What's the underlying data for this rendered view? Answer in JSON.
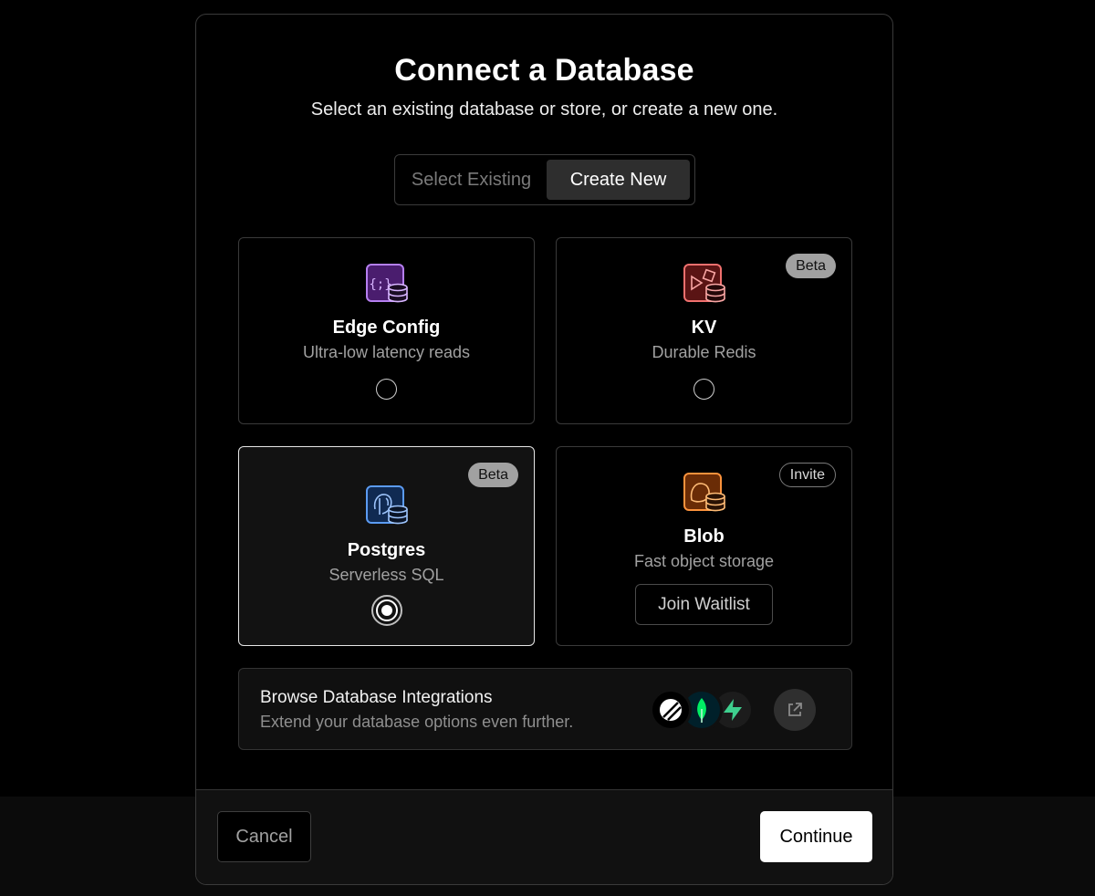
{
  "dialog": {
    "title": "Connect a Database",
    "subtitle": "Select an existing database or store, or create a new one."
  },
  "tabs": [
    {
      "label": "Select Existing",
      "active": false
    },
    {
      "label": "Create New",
      "active": true
    }
  ],
  "options": [
    {
      "title": "Edge Config",
      "description": "Ultra-low latency reads",
      "icon": "edge-config-icon",
      "color": "#a855f7",
      "selected": false
    },
    {
      "title": "KV",
      "description": "Durable Redis",
      "badge": "Beta",
      "icon": "kv-icon",
      "color": "#ef4444",
      "selected": false
    },
    {
      "title": "Postgres",
      "description": "Serverless SQL",
      "badge": "Beta",
      "icon": "postgres-icon",
      "color": "#3b82f6",
      "selected": true
    },
    {
      "title": "Blob",
      "description": "Fast object storage",
      "badge": "Invite",
      "icon": "blob-icon",
      "color": "#f97316",
      "action": "Join Waitlist"
    }
  ],
  "integrations": {
    "title": "Browse Database Integrations",
    "description": "Extend your database options even further.",
    "logos": [
      "planetscale-logo",
      "mongodb-logo",
      "supabase-logo"
    ]
  },
  "footer": {
    "cancel": "Cancel",
    "continue": "Continue"
  }
}
